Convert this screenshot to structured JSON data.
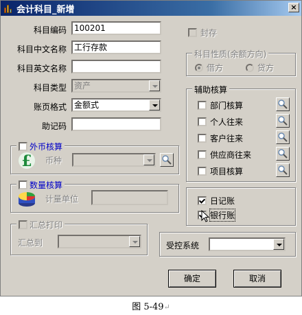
{
  "window": {
    "title": "会计科目_新增",
    "close_label": "×"
  },
  "fields": {
    "code_label": "科目编码",
    "code_value": "100201",
    "cn_name_label": "科目中文名称",
    "cn_name_value": "工行存款",
    "en_name_label": "科目英文名称",
    "en_name_value": "",
    "type_label": "科目类型",
    "type_value": "资产",
    "ledger_format_label": "账页格式",
    "ledger_format_value": "金额式",
    "mnemonic_label": "助记码",
    "mnemonic_value": ""
  },
  "foreign_currency": {
    "label": "外币核算",
    "checked": false,
    "currency_label": "币种",
    "currency_value": ""
  },
  "quantity": {
    "label": "数量核算",
    "checked": false,
    "unit_label": "计量单位",
    "unit_value": ""
  },
  "summary_print": {
    "label": "汇总打印",
    "checked": false,
    "to_label": "汇总到",
    "to_value": ""
  },
  "seal": {
    "label": "封存",
    "checked": false
  },
  "balance_direction": {
    "title": "科目性质(余额方向)",
    "debit": "借方",
    "credit": "贷方",
    "selected": "debit"
  },
  "auxiliary": {
    "title": "辅助核算",
    "items": [
      {
        "label": "部门核算",
        "checked": false
      },
      {
        "label": "个人往来",
        "checked": false
      },
      {
        "label": "客户往来",
        "checked": false
      },
      {
        "label": "供应商往来",
        "checked": false
      },
      {
        "label": "项目核算",
        "checked": false
      }
    ]
  },
  "journals": {
    "daily_journal": {
      "label": "日记账",
      "checked": true
    },
    "bank_journal": {
      "label": "银行账",
      "checked": true
    }
  },
  "controlled_system": {
    "label": "受控系统",
    "value": ""
  },
  "buttons": {
    "ok": "确定",
    "cancel": "取消"
  },
  "caption": "图 5-49"
}
